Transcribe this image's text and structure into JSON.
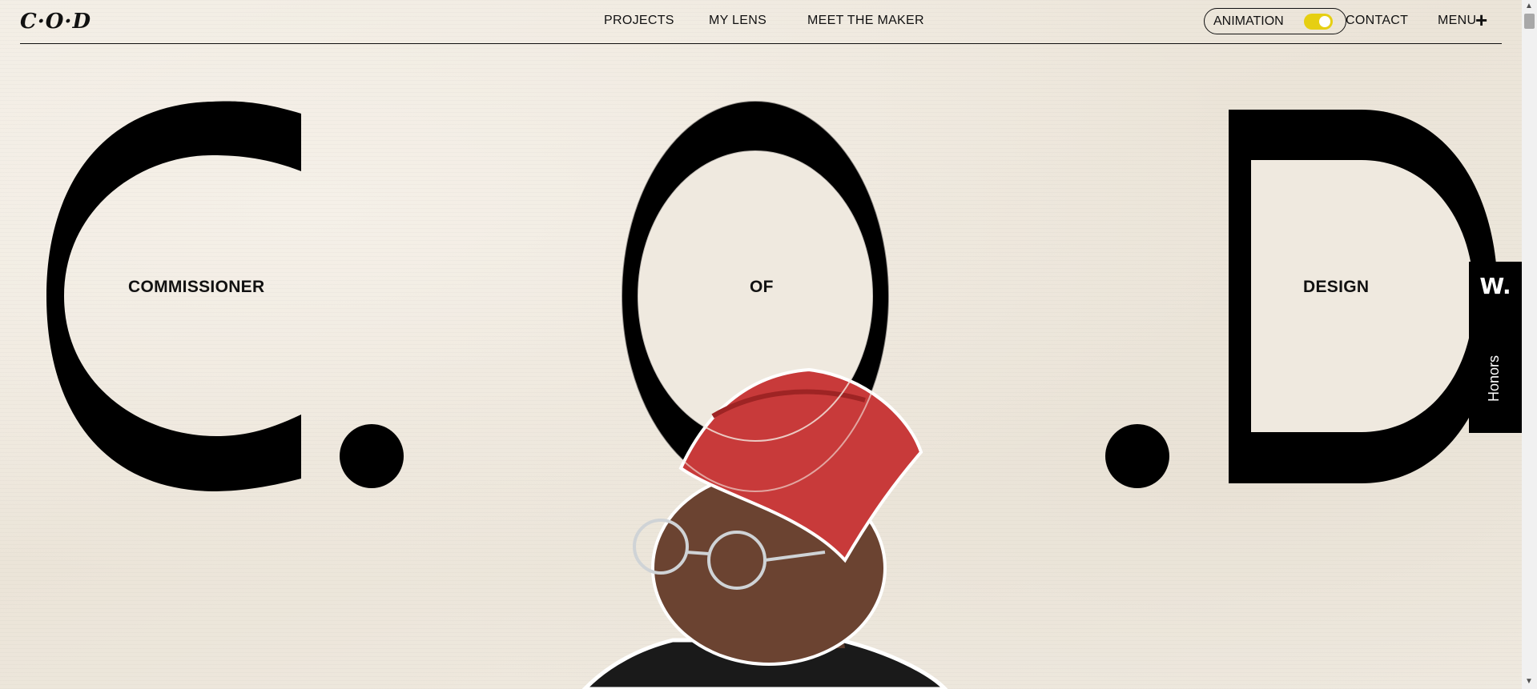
{
  "header": {
    "logo": "C·O·D",
    "nav": [
      "PROJECTS",
      "MY LENS",
      "MEET THE MAKER"
    ],
    "animation_label": "ANIMATION",
    "animation_on": true,
    "contact": "CONTACT",
    "menu": "MENU",
    "menu_icon": "plus-icon"
  },
  "hero": {
    "letters": [
      "C",
      "O",
      "D"
    ],
    "words": [
      "COMMISSIONER",
      "OF",
      "DESIGN"
    ]
  },
  "honors_tab": {
    "mark": "W.",
    "label": "Honors"
  },
  "colors": {
    "background": "#efe9df",
    "text": "#111111",
    "toggle": "#e6cf12",
    "cap": "#c83a3a"
  }
}
